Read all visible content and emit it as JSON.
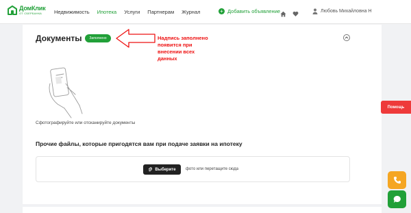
{
  "header": {
    "logo_title": "ДомКлик",
    "logo_subtitle": "ОТ СБЕРБАНКА",
    "nav": [
      {
        "label": "Недвижимость",
        "active": false
      },
      {
        "label": "Ипотека",
        "active": true
      },
      {
        "label": "Услуги",
        "active": false
      },
      {
        "label": "Партнерам",
        "active": false
      },
      {
        "label": "Журнал",
        "active": false
      }
    ],
    "add_ad_label": "Добавить объявление",
    "user_name": "Любовь Михайловна Н",
    "accent_color": "#21a038"
  },
  "documents": {
    "title": "Документы",
    "status_badge": "Заполнено",
    "photo_hint": "Сфотографируйте или отсканируйте документы",
    "other_files_title": "Прочие файлы, которые пригодятся вам при подаче заявки на ипотеку",
    "choose_button": "Выберите",
    "drop_text": "фото или перетащите сюда"
  },
  "annotation": {
    "text_lines": [
      "Надпись заполнено",
      "появится при",
      "внесении всех",
      "данных"
    ],
    "color": "#e11111"
  },
  "floating": {
    "help_label": "Помощь"
  },
  "icons": [
    "logo-icon",
    "plus-circle-icon",
    "home-icon",
    "heart-icon",
    "user-icon",
    "chevron-up-icon",
    "phone-hand-illustration",
    "paperclip-icon",
    "phone-icon",
    "chat-icon",
    "arrow-icon"
  ]
}
